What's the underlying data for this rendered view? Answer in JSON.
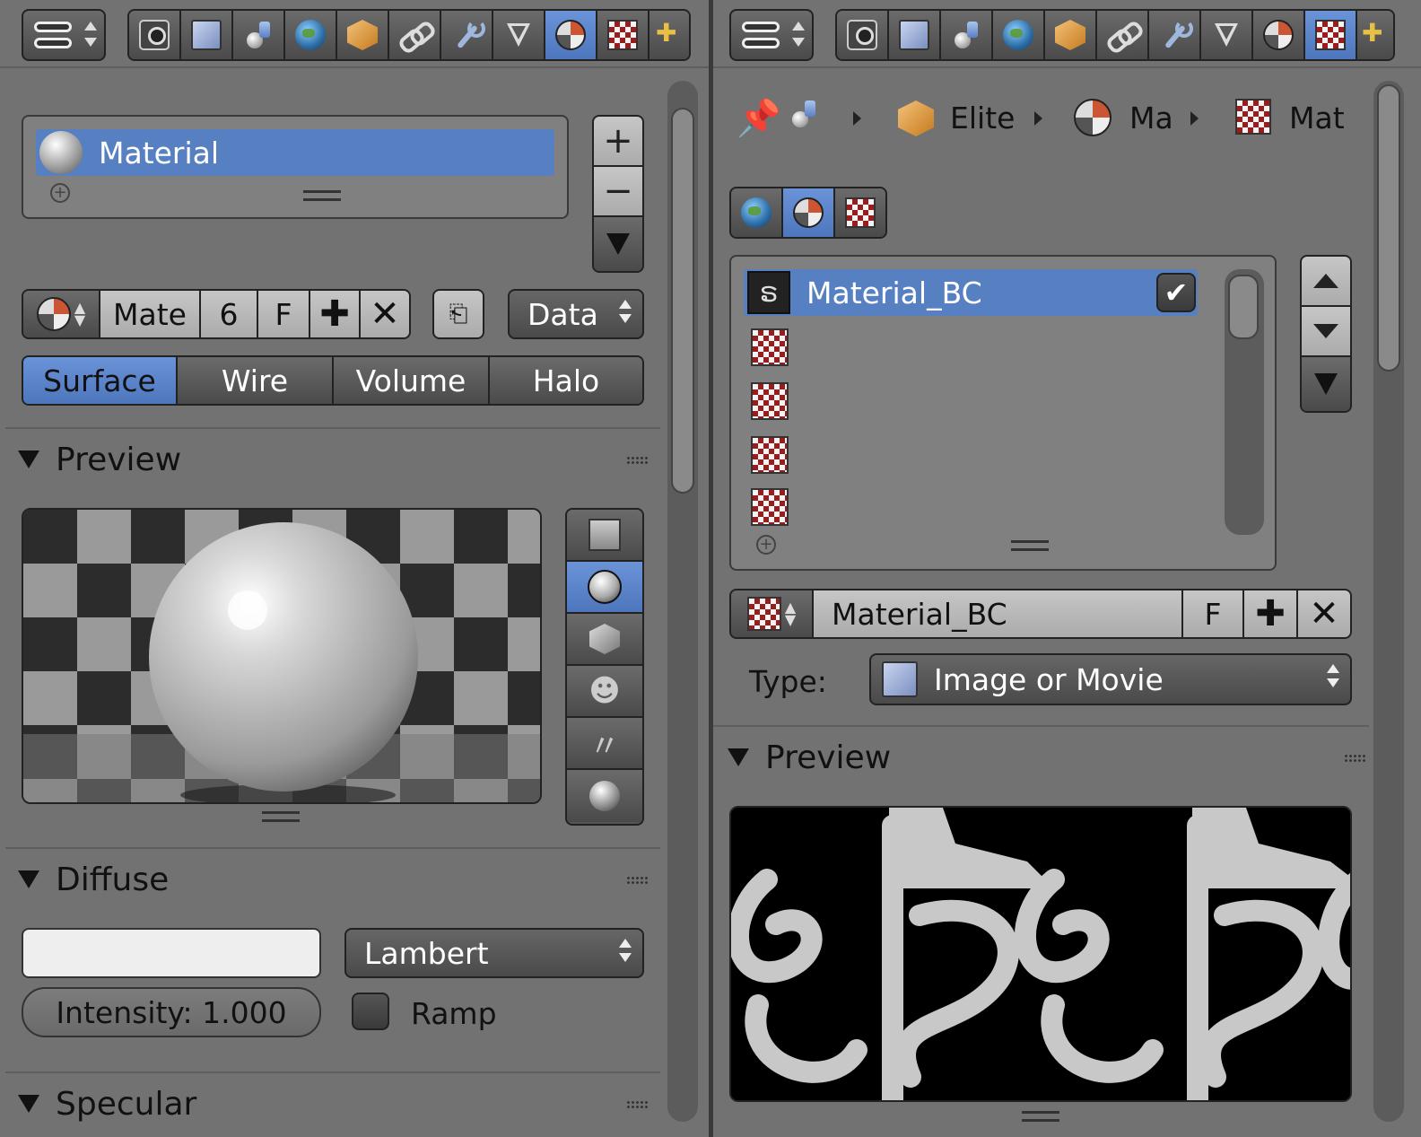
{
  "left": {
    "material_slot": "Material",
    "datablock": {
      "name": "Mate",
      "users": "6",
      "fake_user": "F",
      "data_link": "Data"
    },
    "tabs": [
      {
        "label": "Surface",
        "active": true
      },
      {
        "label": "Wire",
        "active": false
      },
      {
        "label": "Volume",
        "active": false
      },
      {
        "label": "Halo",
        "active": false
      }
    ],
    "preview": {
      "title": "Preview"
    },
    "diffuse": {
      "title": "Diffuse",
      "color": "#eeeeee",
      "shader": "Lambert",
      "intensity": "Intensity: 1.000",
      "ramp_label": "Ramp"
    },
    "specular": {
      "title": "Specular"
    }
  },
  "right": {
    "breadcrumb": {
      "object": "Elite",
      "material": "Ma",
      "texture": "Mat"
    },
    "texture_slot": "Material_BC",
    "datablock": {
      "name": "Material_BC",
      "fake_user": "F"
    },
    "type": {
      "label": "Type:",
      "value": "Image or Movie"
    },
    "preview": {
      "title": "Preview"
    }
  },
  "colors": {
    "panel_bg": "#727272",
    "accent": "#5680c2",
    "texture_red": "#9a1d1d"
  }
}
